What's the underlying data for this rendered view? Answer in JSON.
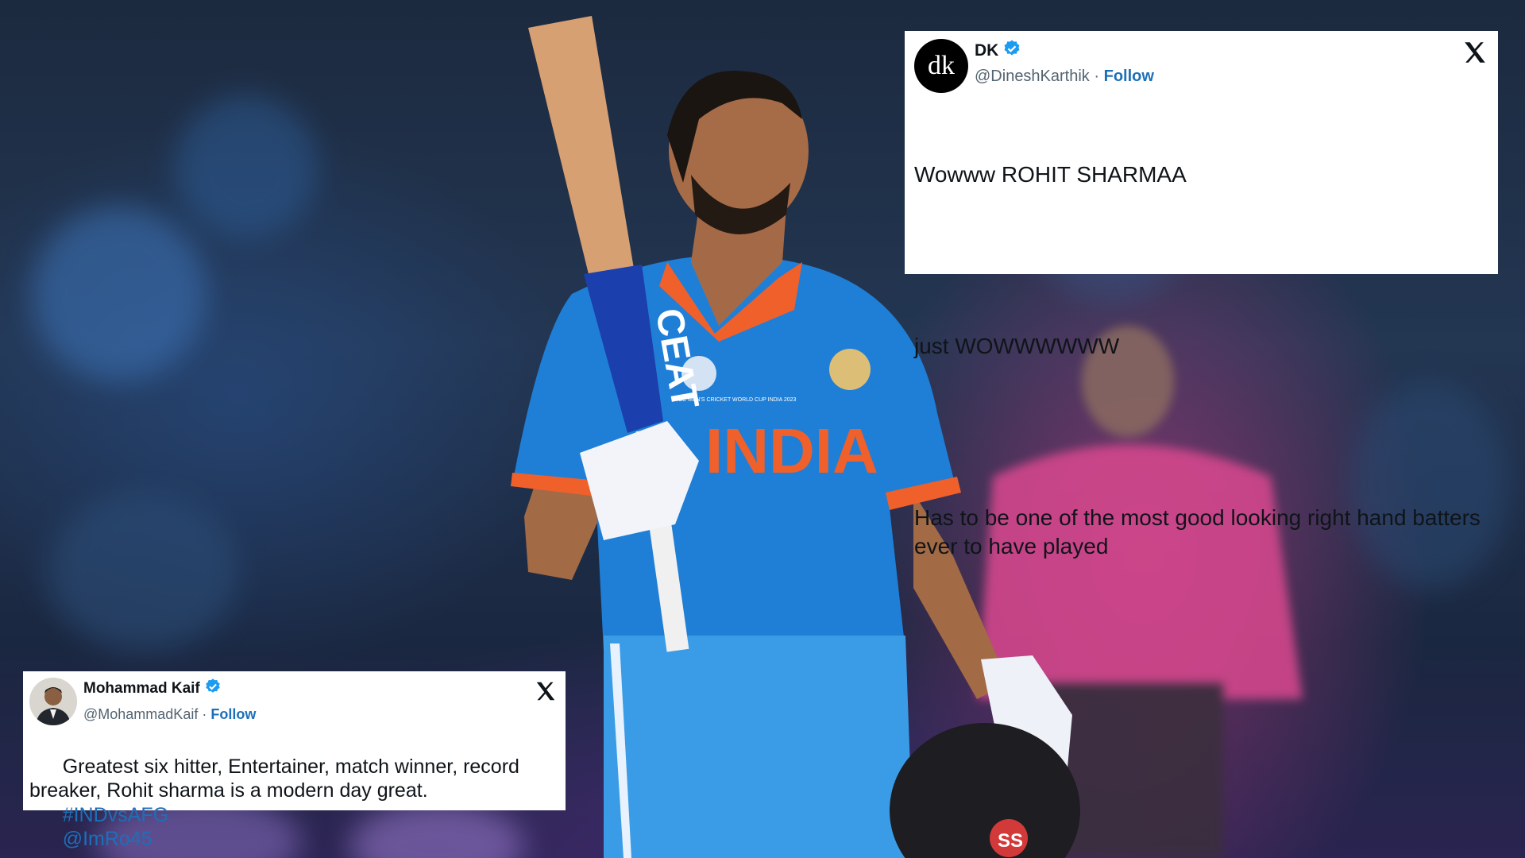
{
  "tweets": {
    "dk": {
      "avatar_text": "dk",
      "name": "DK",
      "handle": "@DineshKarthik",
      "separator": "·",
      "follow": "Follow",
      "line1": "Wowww ROHIT SHARMAA",
      "line2": "just WOWWWWWW",
      "line3": "Has to be one of the most good looking right hand batters ever to have played"
    },
    "kaif": {
      "name": "Mohammad Kaif",
      "handle": "@MohammadKaif",
      "separator": "·",
      "follow": "Follow",
      "text": "Greatest six hitter, Entertainer, match winner, record breaker, Rohit sharma is a modern day great.",
      "hashtag": "#INDvsAFG",
      "mention": "@ImRo45"
    }
  },
  "photo": {
    "jersey_text": "INDIA",
    "bat_sticker": "CEAT",
    "helmet_logo": "SS",
    "badge_text": "ICC MEN'S CRICKET WORLD CUP INDIA 2023"
  },
  "colors": {
    "jersey_blue": "#1f7fd6",
    "jersey_orange": "#f0602a",
    "umpire_pink": "#d9488f",
    "link_blue": "#1d6fb8",
    "verified_blue": "#1d9bf0"
  }
}
